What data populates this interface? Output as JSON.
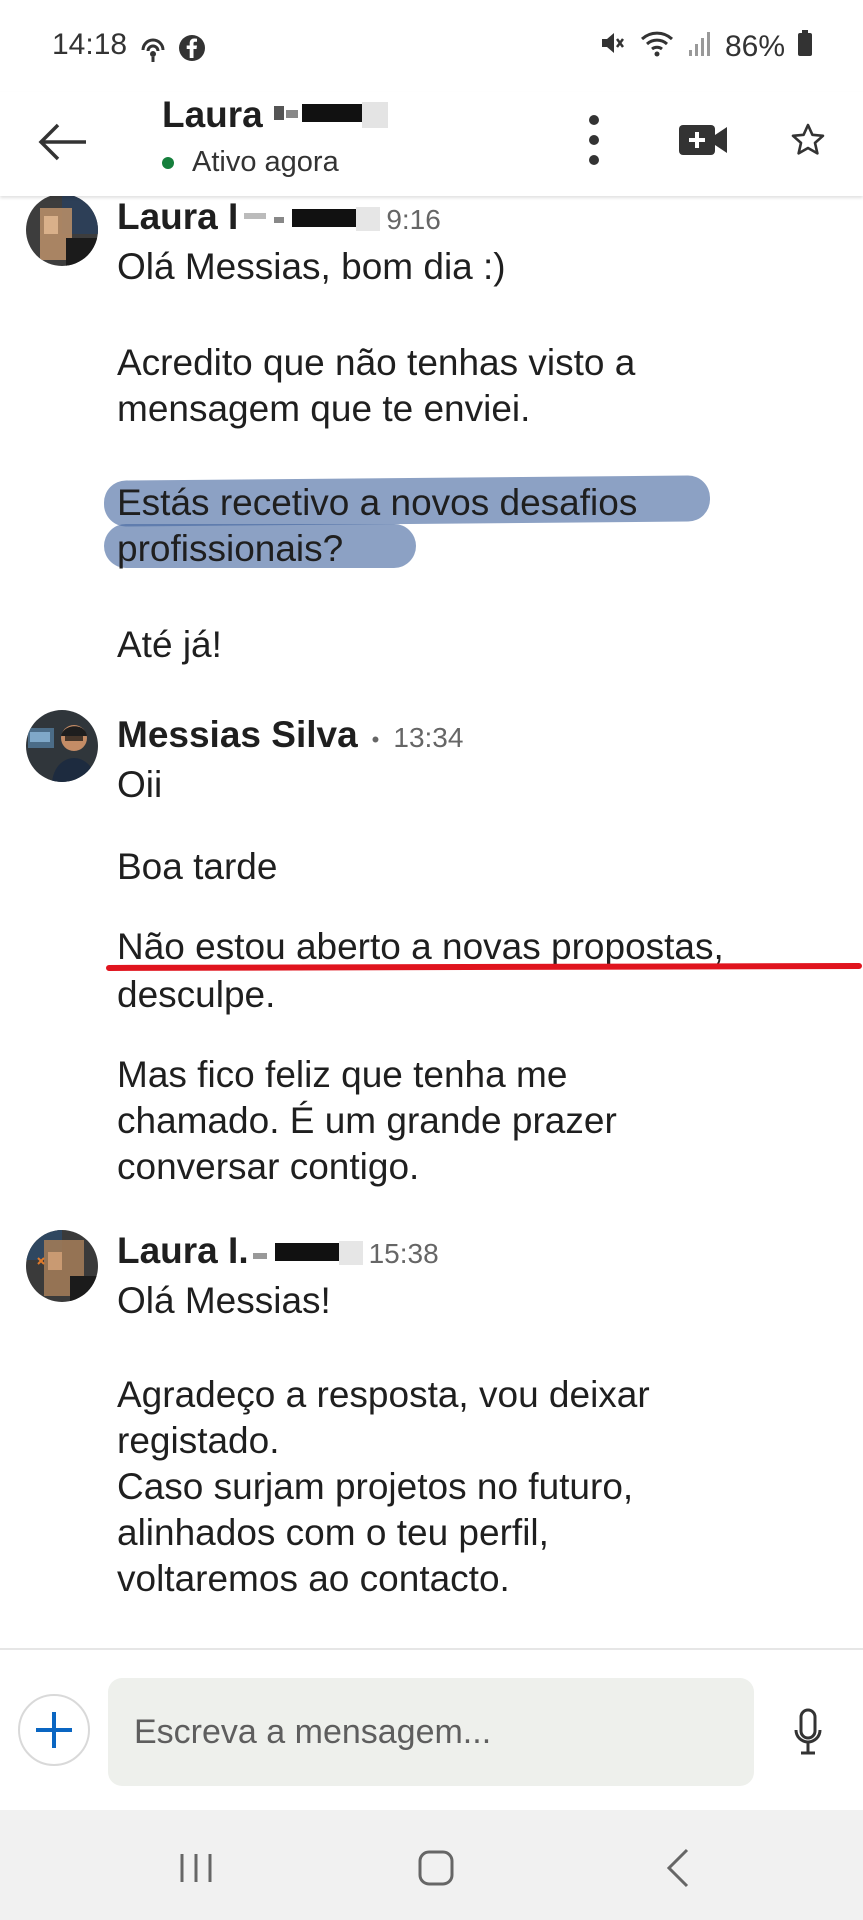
{
  "status_bar": {
    "time": "14:18",
    "battery": "86%",
    "icons_left": [
      "hotspot-icon",
      "facebook-icon"
    ],
    "icons_right": [
      "mute-icon",
      "wifi-icon",
      "signal-icon",
      "battery-icon"
    ]
  },
  "header": {
    "contact_name": "Laura",
    "presence": "Ativo agora",
    "presence_color": "#157f3c",
    "actions": [
      "more-options-icon",
      "video-call-icon",
      "star-icon"
    ]
  },
  "messages": [
    {
      "author": "Laura I",
      "time": "9:16",
      "lines": [
        "Olá Messias, bom dia :)",
        "Acredito que não tenhas visto a",
        "mensagem que te enviei.",
        "Estás recetivo a novos desafios",
        "profissionais?",
        "Até já!"
      ]
    },
    {
      "author": "Messias Silva",
      "separator": "•",
      "time": "13:34",
      "lines": [
        "Oii",
        "Boa tarde",
        "Não estou aberto a novas propostas,",
        "desculpe.",
        "Mas fico feliz que tenha me",
        "chamado. É um grande prazer",
        "conversar contigo."
      ]
    },
    {
      "author": "Laura I.",
      "time": "15:38",
      "lines": [
        "Olá Messias!",
        "Agradeço a resposta, vou deixar",
        "registado.",
        "Caso surjam projetos no futuro,",
        "alinhados com o teu perfil,",
        "voltaremos ao contacto."
      ]
    }
  ],
  "composer": {
    "placeholder": "Escreva a mensagem..."
  },
  "colors": {
    "highlight_blue": "#4668a0",
    "underline_red": "#e0141e"
  }
}
